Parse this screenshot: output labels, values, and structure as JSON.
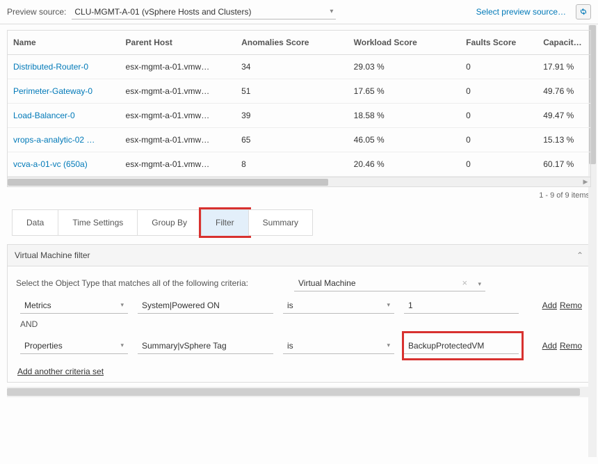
{
  "topbar": {
    "label": "Preview source:",
    "source": "CLU-MGMT-A-01 (vSphere Hosts and Clusters)",
    "select_link": "Select preview source…"
  },
  "table": {
    "headers": [
      "Name",
      "Parent Host",
      "Anomalies Score",
      "Workload Score",
      "Faults Score",
      "Capacity R"
    ],
    "rows": [
      {
        "name": "Distributed-Router-0",
        "parent": "esx-mgmt-a-01.vmw…",
        "anom": "34",
        "work": "29.03 %",
        "fault": "0",
        "cap": "17.91 %"
      },
      {
        "name": "Perimeter-Gateway-0",
        "parent": "esx-mgmt-a-01.vmw…",
        "anom": "51",
        "work": "17.65 %",
        "fault": "0",
        "cap": "49.76 %"
      },
      {
        "name": "Load-Balancer-0",
        "parent": "esx-mgmt-a-01.vmw…",
        "anom": "39",
        "work": "18.58 %",
        "fault": "0",
        "cap": "49.47 %"
      },
      {
        "name": "vrops-a-analytic-02 …",
        "parent": "esx-mgmt-a-01.vmw…",
        "anom": "65",
        "work": "46.05 %",
        "fault": "0",
        "cap": "15.13 %"
      },
      {
        "name": "vcva-a-01-vc (650a)",
        "parent": "esx-mgmt-a-01.vmw…",
        "anom": "8",
        "work": "20.46 %",
        "fault": "0",
        "cap": "60.17 %"
      }
    ],
    "pager": "1 - 9 of 9 items"
  },
  "tabs": {
    "items": [
      "Data",
      "Time Settings",
      "Group By",
      "Filter",
      "Summary"
    ],
    "active_index": 3
  },
  "filter_panel": {
    "title": "Virtual Machine filter",
    "instruction": "Select the Object Type that matches all of the following criteria:",
    "object_type": "Virtual Machine",
    "criteria": [
      {
        "type": "Metrics",
        "sub": "System|Powered ON",
        "op": "is",
        "value": "1",
        "add": "Add",
        "remove": "Remo"
      },
      {
        "type": "Properties",
        "sub": "Summary|vSphere Tag",
        "op": "is",
        "value": "BackupProtectedVM",
        "add": "Add",
        "remove": "Remo",
        "highlight": true
      }
    ],
    "and_label": "AND",
    "add_criteria": "Add another criteria set"
  }
}
